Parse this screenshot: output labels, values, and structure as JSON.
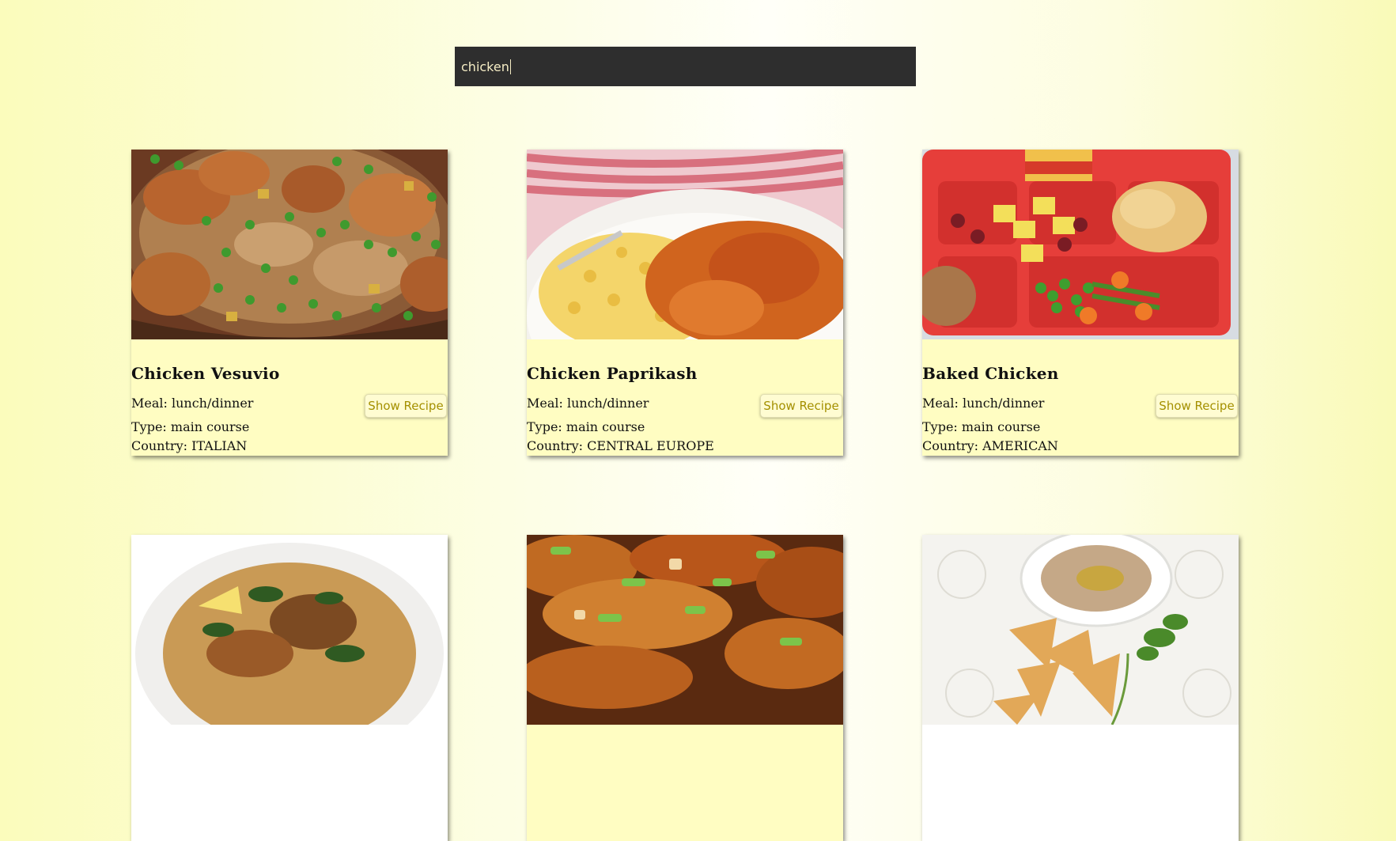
{
  "search": {
    "value": "chicken"
  },
  "recipes": [
    {
      "title": "Chicken Vesuvio",
      "meal": "Meal: lunch/dinner",
      "type": "Type: main course",
      "country": "Country: ITALIAN",
      "button": "Show Recipe",
      "image": "chicken-vesuvio-photo"
    },
    {
      "title": "Chicken Paprikash",
      "meal": "Meal: lunch/dinner",
      "type": "Type: main course",
      "country": "Country: CENTRAL EUROPE",
      "button": "Show Recipe",
      "image": "chicken-paprikash-photo"
    },
    {
      "title": "Baked Chicken",
      "meal": "Meal: lunch/dinner",
      "type": "Type: main course",
      "country": "Country: AMERICAN",
      "button": "Show Recipe",
      "image": "baked-chicken-tray-photo"
    },
    {
      "image": "chicken-soup-bowl-photo"
    },
    {
      "image": "glazed-chicken-photo"
    },
    {
      "image": "hummus-pita-chips-photo"
    }
  ]
}
